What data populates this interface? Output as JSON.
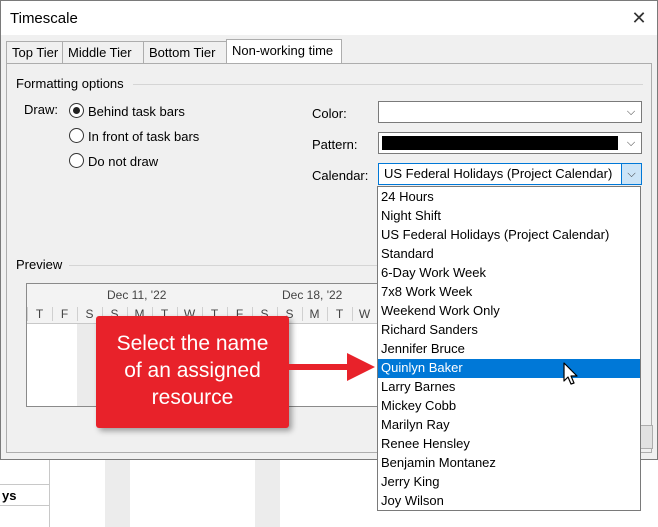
{
  "window": {
    "title": "Timescale",
    "close_glyph": "✕"
  },
  "tabs": [
    {
      "label": "Top Tier",
      "active": false
    },
    {
      "label": "Middle Tier",
      "active": false
    },
    {
      "label": "Bottom Tier",
      "active": false
    },
    {
      "label": "Non-working time",
      "active": true
    }
  ],
  "formatting": {
    "group_label": "Formatting options",
    "draw_label": "Draw:",
    "draw_options": [
      {
        "label": "Behind task bars",
        "checked": true
      },
      {
        "label": "In front of task bars",
        "checked": false
      },
      {
        "label": "Do not draw",
        "checked": false
      }
    ],
    "color_label": "Color:",
    "color_value": "",
    "pattern_label": "Pattern:",
    "pattern_color": "#000000",
    "calendar_label": "Calendar:",
    "calendar_value": "US Federal Holidays (Project Calendar)"
  },
  "preview": {
    "group_label": "Preview",
    "weeks": [
      "Dec 11, '22",
      "Dec 18, '22"
    ],
    "days": [
      "T",
      "F",
      "S",
      "S",
      "M",
      "T",
      "W",
      "T",
      "F",
      "S",
      "S",
      "M",
      "T",
      "W"
    ]
  },
  "calendar_options": [
    "24 Hours",
    "Night Shift",
    "US Federal Holidays (Project Calendar)",
    "Standard",
    "6-Day Work Week",
    "7x8 Work Week",
    "Weekend Work Only",
    "Richard Sanders",
    "Jennifer Bruce",
    "Quinlyn Baker",
    "Larry Barnes",
    "Mickey Cobb",
    "Marilyn Ray",
    "Renee Hensley",
    "Benjamin Montanez",
    "Jerry King",
    "Joy Wilson"
  ],
  "calendar_selected_index": 9,
  "callout": {
    "line1": "Select the name",
    "line2": "of an assigned",
    "line3": "resource",
    "color": "#e8222a"
  },
  "background_app": {
    "row_label": "ys"
  },
  "colors": {
    "selection": "#0078d7",
    "dialog_bg": "#f0f0f0"
  }
}
